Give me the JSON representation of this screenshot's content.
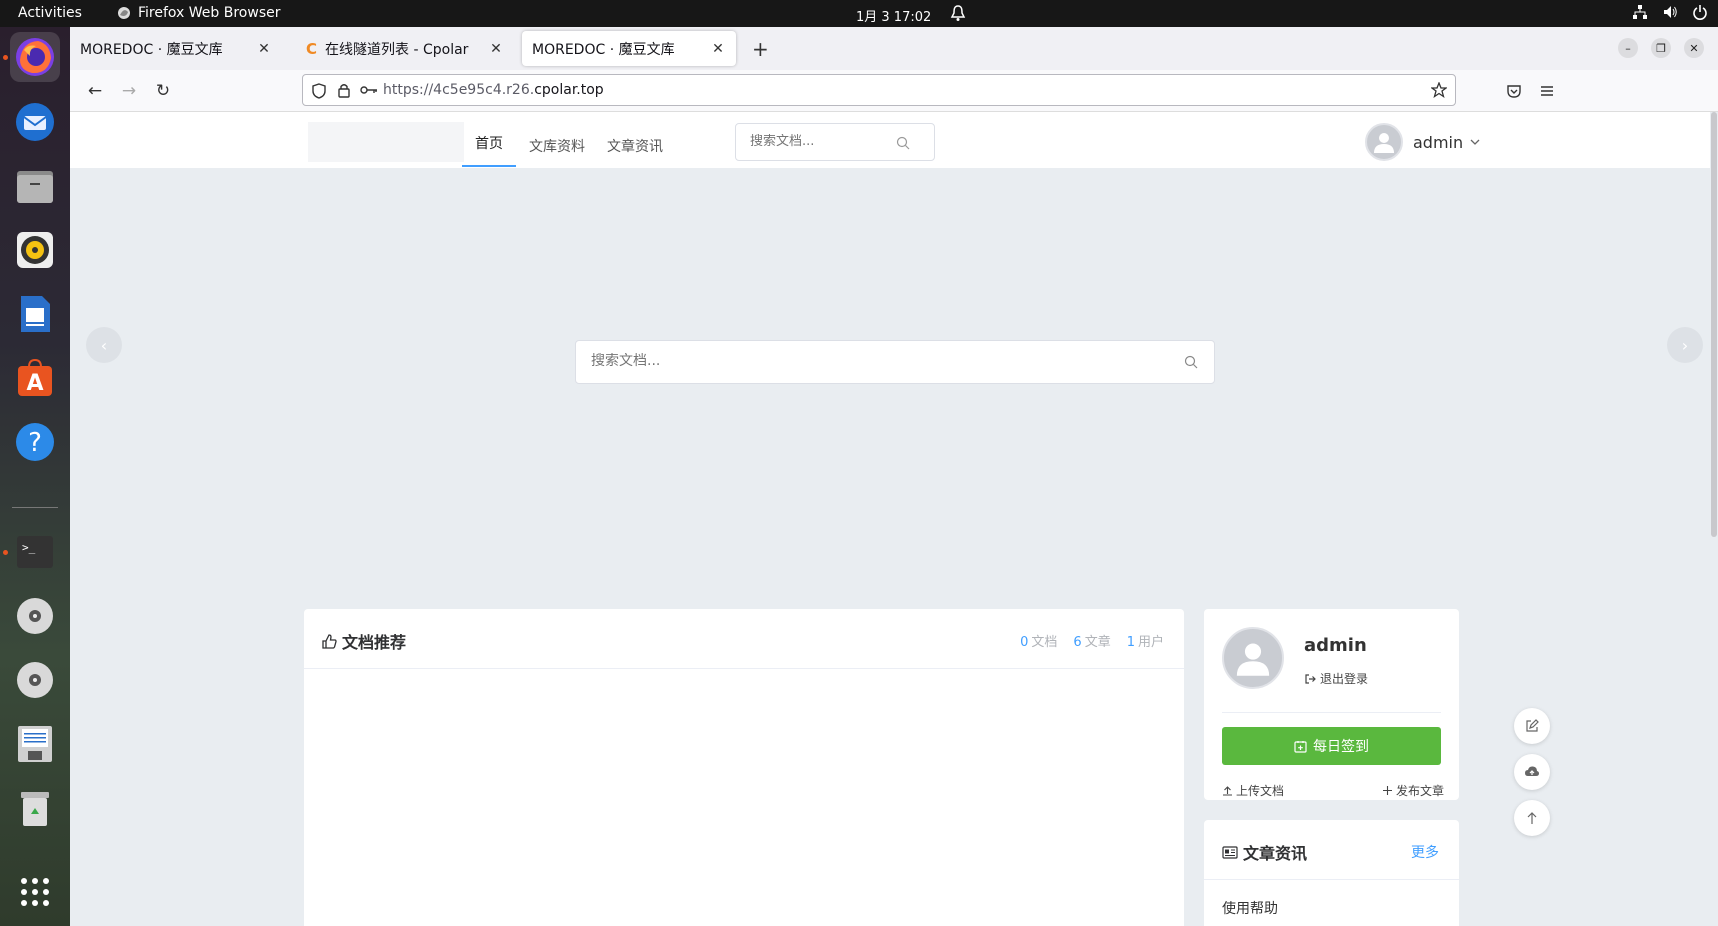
{
  "system": {
    "activities": "Activities",
    "app_name": "Firefox Web Browser",
    "clock": "1月 3  17:02"
  },
  "browser": {
    "tabs": [
      {
        "title": "MOREDOC · 魔豆文库",
        "icon": "moredoc-favicon"
      },
      {
        "title": "在线隧道列表 - Cpolar",
        "icon": "cpolar-favicon"
      },
      {
        "title": "MOREDOC · 魔豆文库",
        "icon": "moredoc-favicon"
      }
    ],
    "url_prefix": "https://4c5e95c4.r26.",
    "url_domain": "cpolar.top"
  },
  "site": {
    "nav": [
      "首页",
      "文库资料",
      "文章资讯"
    ],
    "search_placeholder": "搜索文档...",
    "user_name": "admin",
    "hero_search_placeholder": "搜索文档..."
  },
  "recommend": {
    "title": "文档推荐",
    "stats": [
      {
        "value": "0",
        "label": "文档"
      },
      {
        "value": "6",
        "label": "文章"
      },
      {
        "value": "1",
        "label": "用户"
      }
    ]
  },
  "profile": {
    "name": "admin",
    "logout": "退出登录",
    "checkin": "每日签到",
    "upload": "上传文档",
    "publish": "发布文章"
  },
  "articles": {
    "title": "文章资讯",
    "more": "更多",
    "first_item": "使用帮助"
  },
  "colors": {
    "accent": "#409eff",
    "checkin": "#5ab83e",
    "ubuntu_orange": "#e95420"
  }
}
